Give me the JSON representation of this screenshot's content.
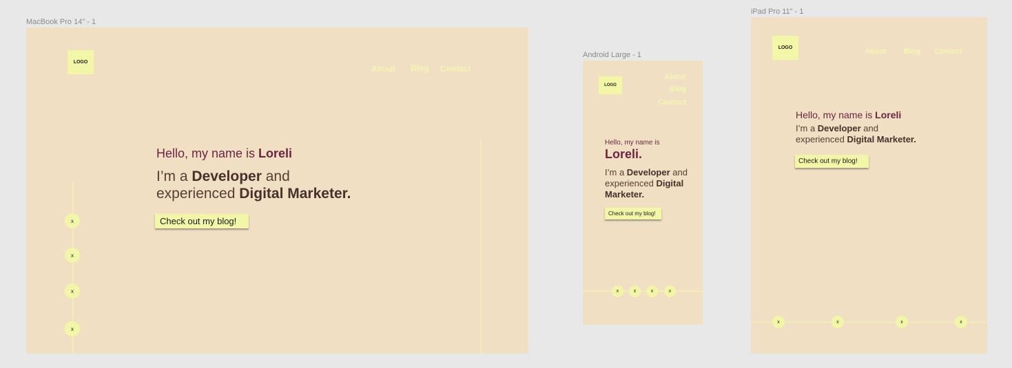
{
  "canvas": {
    "macbook_label": "MacBook Pro 14\" - 1",
    "android_label": "Android Large - 1",
    "ipad_label": "iPad Pro 11\" - 1"
  },
  "site": {
    "logo": "LOGO",
    "nav": [
      "About",
      "Blog",
      "Contact"
    ],
    "hello_prefix": "Hello, my name is ",
    "name": "Loreli",
    "name_mobile": "Loreli.",
    "tagline_im": "I’m a ",
    "tagline_role": "Developer",
    "tagline_and": " and",
    "tagline_and_experienced": " and experienced ",
    "tagline_experienced": "experienced ",
    "tagline_marketer": "Digital Marketer.",
    "cta": "Check out my blog!",
    "social_icon_label": "x"
  },
  "colors": {
    "background": "#f0dfc3",
    "accent": "#f2f7a8",
    "name_color": "#6b2540",
    "text_color": "#5a3c36"
  }
}
